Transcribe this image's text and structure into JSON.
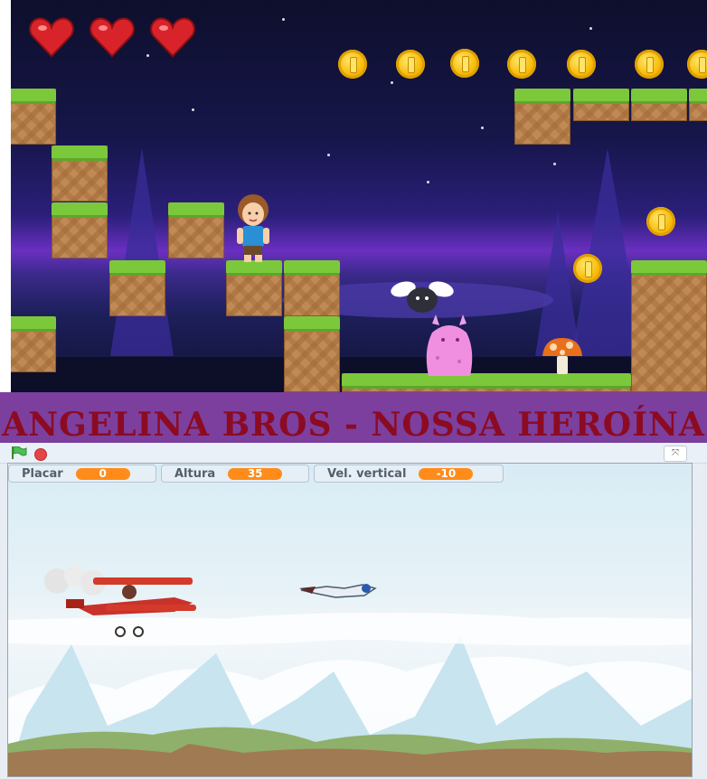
{
  "title": "ANGELINA BROS - NOSSA HEROÍNA",
  "game": {
    "lives": 3,
    "hearts": [
      "heart-icon",
      "heart-icon",
      "heart-icon"
    ],
    "coin_count_visible": 10
  },
  "scratch": {
    "fullscreen_label": "⤧",
    "monitors": [
      {
        "label": "Placar",
        "value": "0"
      },
      {
        "label": "Altura",
        "value": "35"
      },
      {
        "label": "Vel. vertical",
        "value": "-10"
      }
    ]
  },
  "colors": {
    "title_bg": "#7c3f9e",
    "title_text": "#8c0b22",
    "monitor_value": "#ff8c1a",
    "grass": "#7cc83b",
    "coin": "#f6b800"
  }
}
